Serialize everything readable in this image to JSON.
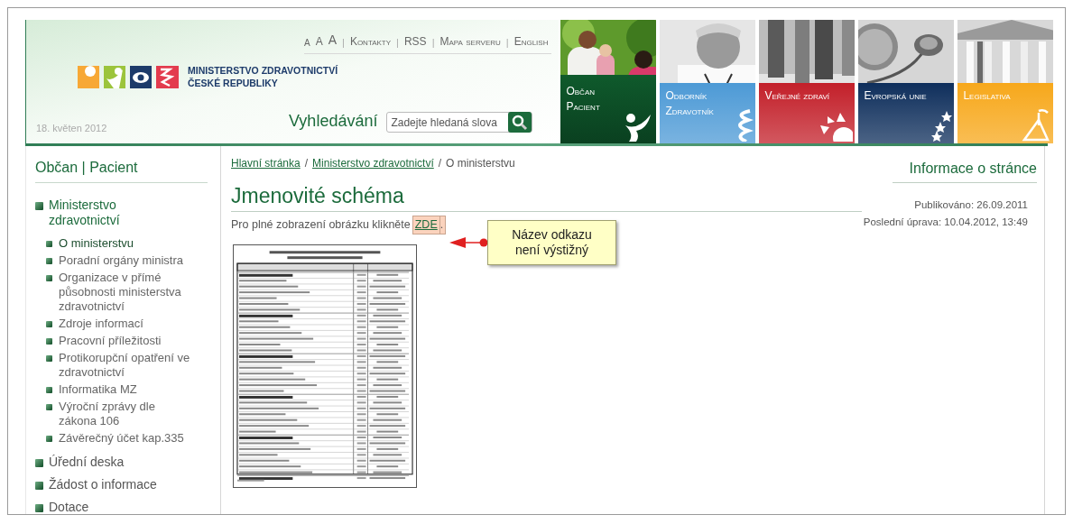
{
  "header": {
    "font_size_links": [
      "A",
      "A",
      "A"
    ],
    "links": [
      "Kontakty",
      "RSS",
      "Mapa serveru",
      "English"
    ],
    "separator": "|",
    "logo_lines": [
      "MINISTERSTVO ZDRAVOTNICTVÍ",
      "ČESKÉ REPUBLIKY"
    ],
    "date": "18. květen 2012",
    "search": {
      "label": "Vyhledávání",
      "placeholder": "Zadejte hledaná slova"
    }
  },
  "tiles": [
    {
      "lines": [
        "Občan",
        "Pacient"
      ],
      "color": "#0f5a2c",
      "selected": true
    },
    {
      "lines": [
        "Odborník",
        "Zdravotník"
      ],
      "color": "#4d9ad6",
      "selected": false
    },
    {
      "lines": [
        "Veřejné zdraví"
      ],
      "color": "#c3202a",
      "selected": false
    },
    {
      "lines": [
        "Evropská unie"
      ],
      "color": "#0f2f5c",
      "selected": false
    },
    {
      "lines": [
        "Legislativa"
      ],
      "color": "#f7a81b",
      "selected": false
    }
  ],
  "sidebar": {
    "heading": "Občan | Pacient",
    "items": [
      {
        "label": "Ministerstvo zdravotnictví",
        "expanded": true,
        "children": [
          {
            "label": "O ministerstvu",
            "selected": true
          },
          {
            "label": "Poradní orgány ministra",
            "selected": false
          },
          {
            "label": "Organizace v přímé působnosti ministerstva zdravotnictví",
            "selected": false
          },
          {
            "label": "Zdroje informací",
            "selected": false
          },
          {
            "label": "Pracovní příležitosti",
            "selected": false
          },
          {
            "label": "Protikorupční opatření ve zdravotnictví",
            "selected": false
          },
          {
            "label": "Informatika MZ",
            "selected": false
          },
          {
            "label": "Výroční zprávy dle zákona 106",
            "selected": false
          },
          {
            "label": "Závěrečný účet kap.335",
            "selected": false
          }
        ]
      },
      {
        "label": "Úřední deska",
        "expanded": false
      },
      {
        "label": "Žádost o informace",
        "expanded": false
      },
      {
        "label": "Dotace",
        "expanded": false
      }
    ]
  },
  "breadcrumb": {
    "links": [
      "Hlavní stránka",
      "Ministerstvo zdravotnictví"
    ],
    "current": "O ministerstvu",
    "separator": "/"
  },
  "content": {
    "title": "Jmenovité schéma",
    "text": "Pro plné zobrazení obrázku klikněte",
    "link": "ZDE",
    "after_link": "."
  },
  "callout": {
    "text": "Název odkazu není výstižný"
  },
  "page_info": {
    "heading": "Informace o stránce",
    "published": "Publikováno: 26.09.2011",
    "modified": "Poslední úprava: 10.04.2012, 13:49"
  }
}
